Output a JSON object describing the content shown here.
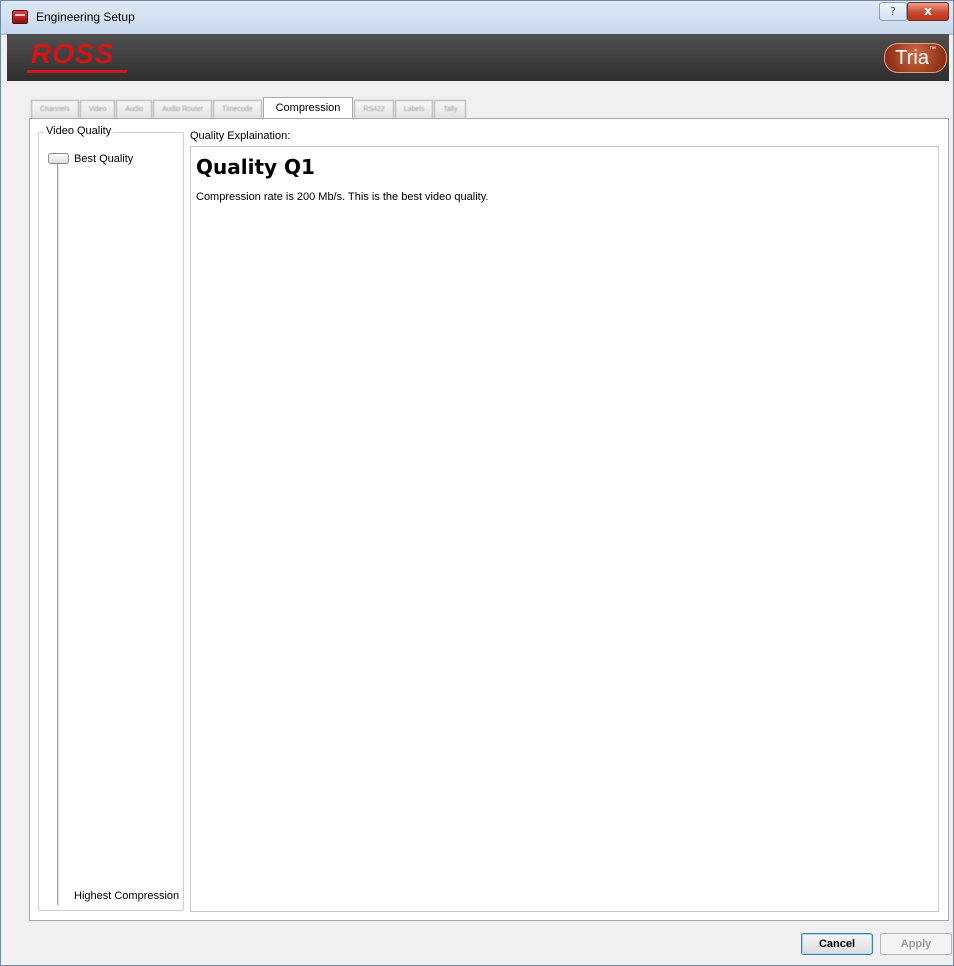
{
  "window": {
    "title": "Engineering Setup",
    "help_glyph": "?",
    "close_glyph": "x"
  },
  "banner": {
    "brand": "ROSS",
    "product": "Tria"
  },
  "tabs": [
    {
      "label": "Channels",
      "active": false
    },
    {
      "label": "Video",
      "active": false
    },
    {
      "label": "Audio",
      "active": false
    },
    {
      "label": "Audio Router",
      "active": false
    },
    {
      "label": "Timecode",
      "active": false
    },
    {
      "label": "Compression",
      "active": true
    },
    {
      "label": "RS422",
      "active": false
    },
    {
      "label": "Labels",
      "active": false
    },
    {
      "label": "Tally",
      "active": false
    }
  ],
  "video_quality": {
    "group_title": "Video Quality",
    "top_label": "Best Quality",
    "bottom_label": "Highest Compression",
    "slider_position_fraction": 0.0
  },
  "explanation": {
    "label": "Quality Explaination:",
    "heading": "Quality Q1",
    "text": "Compression rate is 200 Mb/s. This is the best video quality."
  },
  "footer": {
    "cancel_label": "Cancel",
    "apply_label": "Apply"
  },
  "colors": {
    "brand_red": "#d01616",
    "tria_orange": "#b0461f"
  }
}
